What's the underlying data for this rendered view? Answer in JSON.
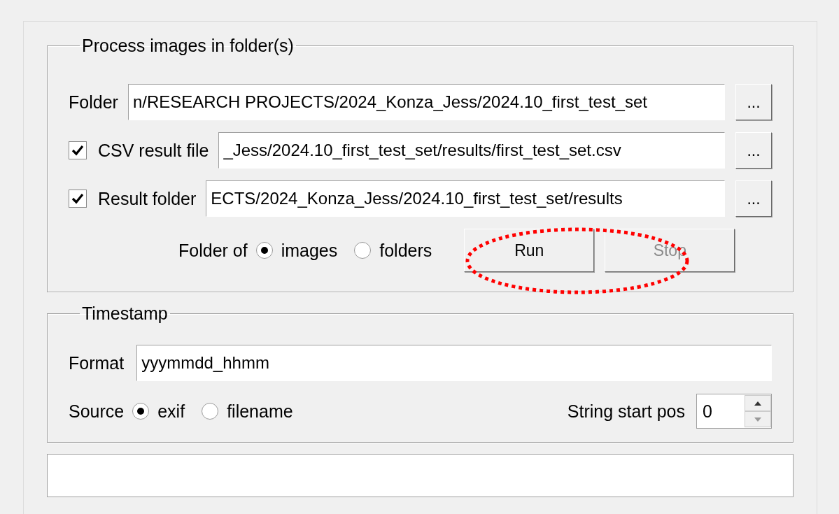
{
  "process_group": {
    "title": "Process images in folder(s)",
    "rows": [
      {
        "kind": "plain",
        "label": "Folder",
        "value": "n/RESEARCH PROJECTS/2024_Konza_Jess/2024.10_first_test_set",
        "browse": "..."
      },
      {
        "kind": "checkbox",
        "label": "CSV result file",
        "checked": true,
        "value": "_Jess/2024.10_first_test_set/results/first_test_set.csv",
        "browse": "..."
      },
      {
        "kind": "checkbox",
        "label": "Result folder",
        "checked": true,
        "value": "ECTS/2024_Konza_Jess/2024.10_first_test_set/results",
        "browse": "..."
      }
    ],
    "folder_of": {
      "label": "Folder of",
      "options": [
        {
          "label": "images",
          "selected": true
        },
        {
          "label": "folders",
          "selected": false
        }
      ]
    },
    "buttons": [
      {
        "label": "Run",
        "disabled": false
      },
      {
        "label": "Stop",
        "disabled": true
      }
    ],
    "highlight": {
      "kind": "dotted-ellipse",
      "color": "#ff0000"
    }
  },
  "timestamp_group": {
    "title": "Timestamp",
    "format": {
      "label": "Format",
      "value": "yyymmdd_hhmm"
    },
    "source": {
      "label": "Source",
      "options": [
        {
          "label": "exif",
          "selected": true
        },
        {
          "label": "filename",
          "selected": false
        }
      ]
    },
    "start_pos": {
      "label": "String start pos",
      "value": "0"
    }
  }
}
